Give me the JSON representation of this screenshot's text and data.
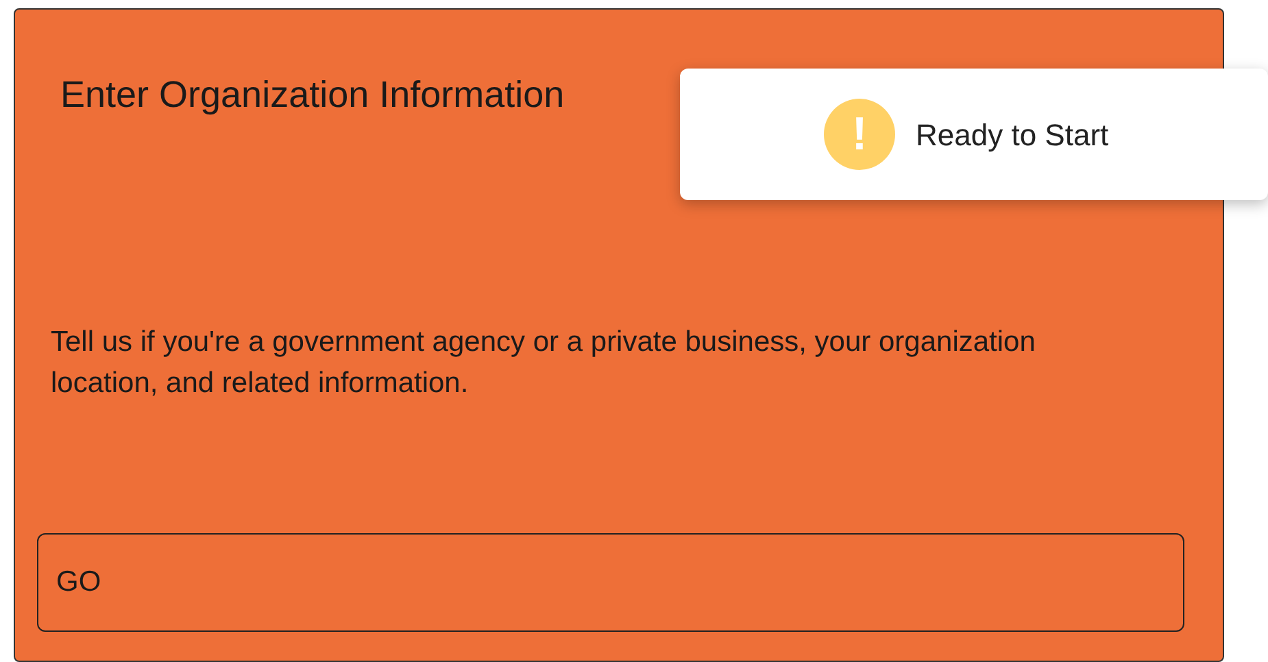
{
  "card": {
    "title": "Enter Organization Information",
    "description": "Tell us if you're a government agency or a private business, your organization location, and related information.",
    "button": "GO"
  },
  "toast": {
    "icon": "!",
    "message": "Ready to Start"
  }
}
